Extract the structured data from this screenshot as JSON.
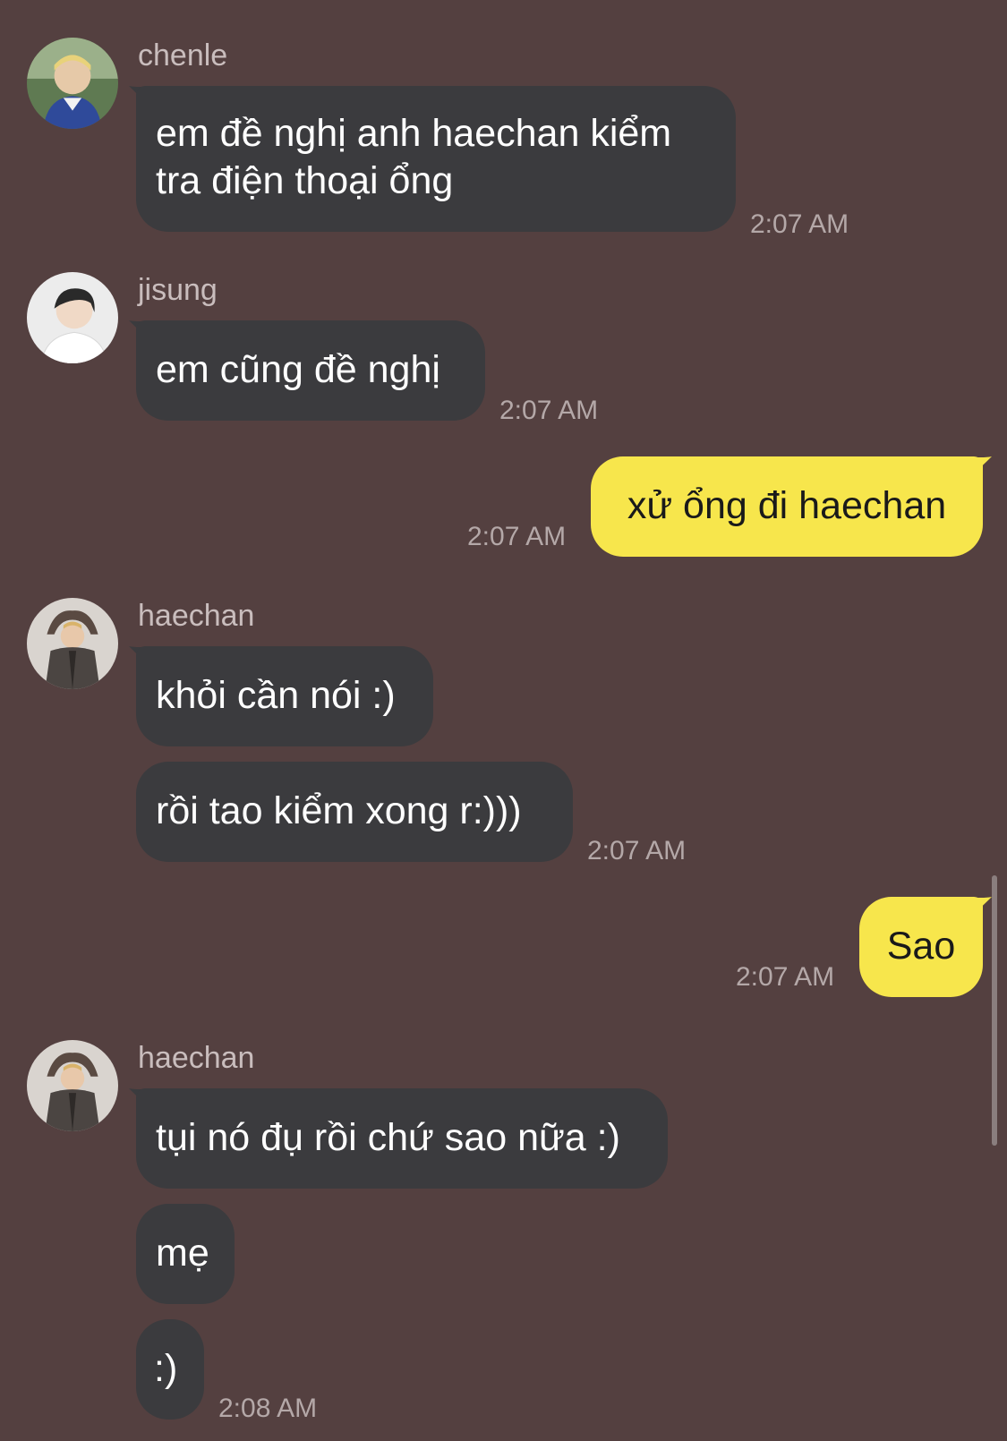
{
  "messages": [
    {
      "sender": "chenle",
      "lines": [
        "em đề nghị anh haechan kiểm",
        "tra điện thoại ổng"
      ],
      "time": "2:07 AM"
    },
    {
      "sender": "jisung",
      "text": "em cũng đề nghị",
      "time": "2:07 AM"
    },
    {
      "sender": "me",
      "text": "xử ổng đi haechan",
      "time": "2:07 AM"
    },
    {
      "sender": "haechan",
      "text": "khỏi cần nói :)"
    },
    {
      "text": "rồi tao kiểm xong r:)))",
      "time": "2:07 AM"
    },
    {
      "sender": "me",
      "text": "Sao",
      "time": "2:07 AM"
    },
    {
      "sender": "haechan",
      "text": "tụi nó đụ rồi chứ sao nữa :)"
    },
    {
      "text": "mẹ"
    },
    {
      "text": ":)",
      "time": "2:08 AM"
    }
  ],
  "colors": {
    "background": "#544040",
    "incoming_bubble": "#3b3b3e",
    "outgoing_bubble": "#f7e64c"
  },
  "icons": {
    "avatar_chenle": "avatar-photo",
    "avatar_jisung": "avatar-photo",
    "avatar_haechan": "avatar-photo"
  }
}
